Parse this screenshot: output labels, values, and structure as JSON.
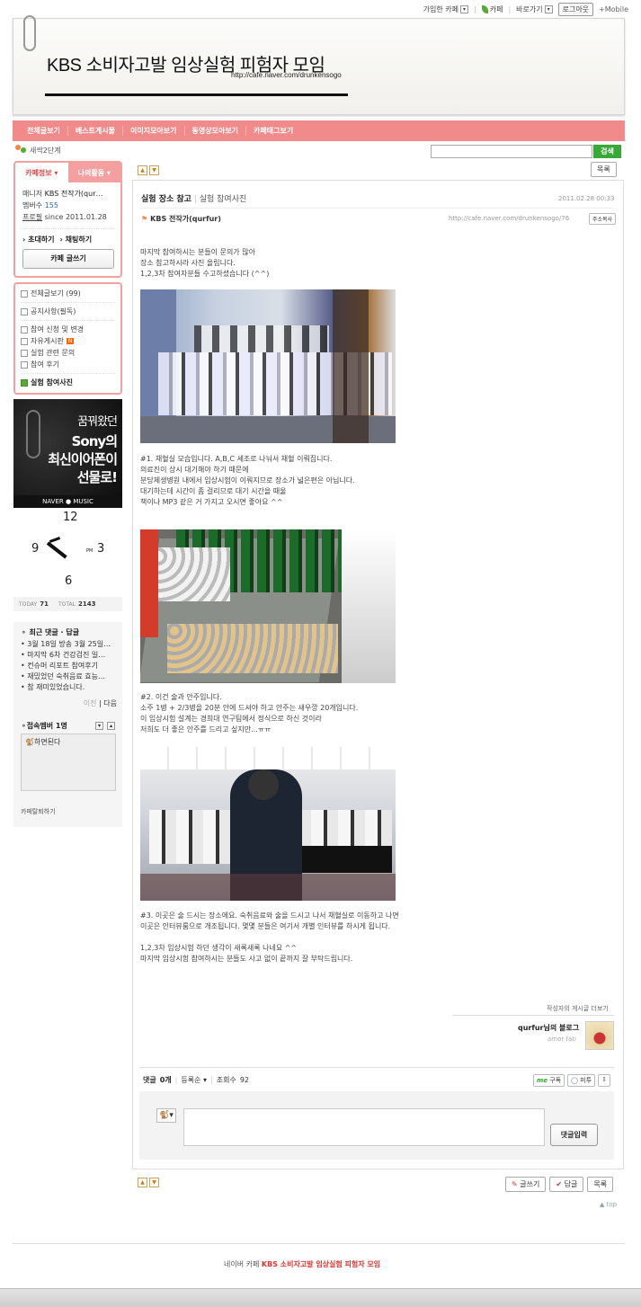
{
  "topbar": {
    "joined": "가입한 카페",
    "cafe": "카페",
    "shortcut": "바로가기",
    "login": "로그아웃",
    "mobile": "+Mobile"
  },
  "header": {
    "title": "KBS 소비자고발 임상실험 피험자 모임",
    "url": "http://cafe.naver.com/drunkensogo"
  },
  "nav": [
    "전체글보기",
    "베스트게시물",
    "이미지모아보기",
    "동영상모아보기",
    "카페태그보기"
  ],
  "level": "새싹2단계",
  "search": {
    "button": "검색"
  },
  "sidebar": {
    "tab_info": "카페정보 ▾",
    "tab_activity": "나의활동 ▾",
    "manager_label": "매니저",
    "manager_name": "KBS 전작가(qur…",
    "members_label": "멤버수",
    "members_count": "155",
    "profile_label": "프로필",
    "since": "since 2011.01.28",
    "invite": "› 초대하기",
    "chat": "› 채팅하기",
    "write": "카페 글쓰기",
    "menu": [
      "전체글보기 (99)",
      "공지사항(필독)",
      "참여 신청 및 변경",
      "자유게시판",
      "실험 관련 문의",
      "참여 후기",
      "실험 참여사진"
    ],
    "new_badge": "N"
  },
  "ad": {
    "line1": "꿈꿔왔던",
    "line2": "Sony의",
    "line3": "최신이어폰이",
    "line4": "선물로!",
    "footer": "NAVER ● MUSIC"
  },
  "clock": {
    "n12": "12",
    "n9": "9",
    "n3": "3",
    "n6": "6",
    "pm": "PM"
  },
  "visitors": {
    "today_label": "TODAY",
    "today": "71",
    "total_label": "TOTAL",
    "total": "2143"
  },
  "recent": {
    "title": "최근 댓글 · 답글",
    "items": [
      "3월 18일 방송 3월 25일…",
      "마지막 6차 건강검진 일…",
      "컨슈머 리포트 참여후기",
      "재밌었던 숙취음료 효능…",
      "참 재미있었습니다."
    ],
    "prev": "이전",
    "next": "다음"
  },
  "online": {
    "title": "접속멤버 1명",
    "member": "하면된다"
  },
  "leave": "카페탈퇴하기",
  "post": {
    "list_btn": "목록",
    "subject": "실험 장소 참고",
    "board": "실험 참여사진",
    "date": "2011.02.28 00:33",
    "author": "KBS 전작가(qurfur)",
    "link": "http://cafe.naver.com/drunkensogo/76",
    "copy_url": "주소복사",
    "intro": [
      "마지막 참여하시는 분들이 문의가 많아",
      "장소 참고하시라 사진 올립니다.",
      "1,2,3차 참여자분들 수고하셨습니다 (^^)"
    ],
    "cap1": [
      "#1. 채혈실 모습입니다. A,B,C 세조로 나눠서 채혈 이뤄집니다.",
      "의료진이 상시 대기해야 하기 때문에",
      "분당제생병원 내에서 임상시험이 이뤄지므로 장소가 넓은편은 아닙니다.",
      "대기하는데 시간이 좀 걸리므로 대기 시간을 때울",
      "책이나 MP3 같은 거 가지고 오시면 좋아요 ^^"
    ],
    "cap2": [
      "#2. 이건 술과 안주입니다.",
      "소주 1병 + 2/3병을 20분 안에 드셔야 하고 안주는 새우깡 20개입니다.",
      "이 임상시험 설계는 경희대 연구팀에서 정식으로 하신 것이라",
      "저희도 더 좋은 안주를 드리고 싶지만...ㅠㅠ"
    ],
    "cap3": [
      "#3. 이곳은 술 드시는 장소에요. 숙취음료와 술을 드시고 나서 채혈실로 이동하고 나면",
      "이곳은 인터뷰룸으로 개조됩니다. 몇몇 분들은 여기서 개별 인터뷰를 하시게 됩니다.",
      "",
      "1,2,3차 임상시험 하던 생각이 새록새록 나네요 ^^",
      "마지막 임상시험 참여하시는 분들도 사고 없이 끝까지 잘 부탁드립니다."
    ],
    "more_posts": "작성자의 게시글 더보기",
    "blog_name": "qurfur님의 블로그",
    "blog_sub": "amor fati",
    "comments_label": "댓글",
    "comments_count": "0개",
    "sort": "등록순 ▾",
    "views_label": "조회수",
    "views": "92",
    "me_sub": "구독",
    "me_too": "미투",
    "submit": "댓글입력",
    "write": "글쓰기",
    "reply": "답글",
    "list": "목록",
    "top": "▲ top"
  },
  "footer": {
    "prefix": "네이버 카페",
    "cafe_name": "KBS 소비자고발 임상실험 피험자 모임"
  }
}
